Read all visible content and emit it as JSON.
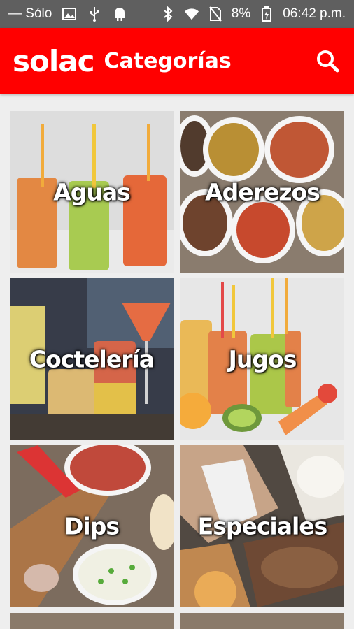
{
  "status_bar": {
    "carrier": "Sólo",
    "battery": "8%",
    "time": "06:42 p.m."
  },
  "app_bar": {
    "logo": "solac",
    "title": "Categorías",
    "search_icon": "search-icon"
  },
  "categories": [
    {
      "label": "Aguas"
    },
    {
      "label": "Aderezos"
    },
    {
      "label": "Coctelería"
    },
    {
      "label": "Jugos"
    },
    {
      "label": "Dips"
    },
    {
      "label": "Especiales"
    }
  ],
  "colors": {
    "app_bar": "#ff0000",
    "status_bar": "#5f5f5f",
    "background": "#eeeeee"
  }
}
